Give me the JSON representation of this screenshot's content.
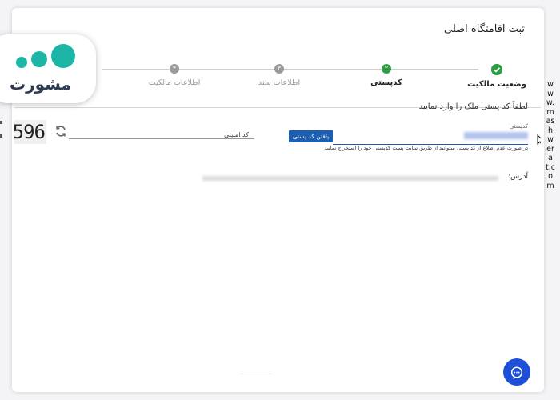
{
  "title": "ثبت اقامتگاه اصلی",
  "steps": [
    {
      "number": "✓",
      "label": "وضعیت مالکیت",
      "state": "done"
    },
    {
      "number": "۲",
      "label": "کدپستی",
      "state": "active"
    },
    {
      "number": "۳",
      "label": "اطلاعات سند",
      "state": "pending"
    },
    {
      "number": "۴",
      "label": "اطلاعات مالکیت",
      "state": "pending"
    }
  ],
  "instruction": "لطفاً کد پستی ملک را وارد نمایید",
  "postal": {
    "label": "کدپستی",
    "find_button": "یافتن کد پستی",
    "help_text": "در صورت عدم اطلاع از کد پستی میتوانید از طریق سایت پست کدپستی خود را استخراج نمایید"
  },
  "security": {
    "label": "کد امنیتی",
    "captcha": "596"
  },
  "address": {
    "label": "آدرس:"
  },
  "logo": {
    "text": "مشورت"
  },
  "watermark": "www.mashwerat.com",
  "colors": {
    "accent": "#1a5fb4",
    "success": "#2e9d44",
    "brand": "#1db6a6",
    "chat": "#1e4fd8"
  }
}
